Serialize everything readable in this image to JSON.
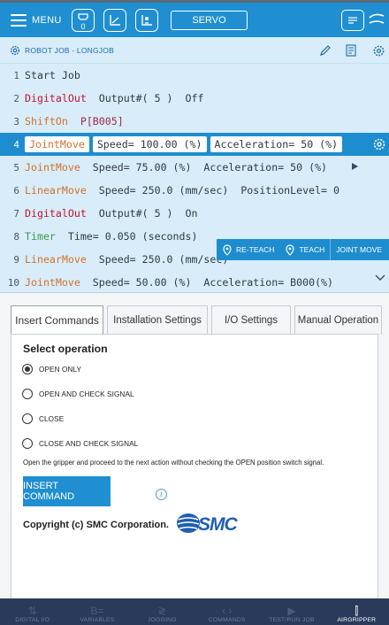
{
  "topbar": {
    "menu_label": "MENU",
    "servo_label": "SERVO",
    "gripper_badge": "0",
    "accent_color": "#1f8fd1"
  },
  "job": {
    "title": "ROBOT JOB - LONGJOB",
    "lines": [
      {
        "num": "1",
        "keyword": "Start Job",
        "rest": ""
      },
      {
        "num": "2",
        "keyword": "DigitalOut",
        "rest": "  Output#( 5 )  Off"
      },
      {
        "num": "3",
        "keyword": "ShiftOn",
        "rest": "  P[B005]"
      },
      {
        "num": "4",
        "keyword": "JointMove",
        "chip1": "Speed= 100.00 (%)",
        "chip2": "Acceleration= 50 (%)"
      },
      {
        "num": "5",
        "keyword": "JointMove",
        "rest": "  Speed= 75.00 (%)  Acceleration= 50 (%)"
      },
      {
        "num": "6",
        "keyword": "LinearMove",
        "rest": "  Speed= 250.0 (mm/sec)  PositionLevel= 0"
      },
      {
        "num": "7",
        "keyword": "DigitalOut",
        "rest": "  Output#( 5 )  On"
      },
      {
        "num": "8",
        "keyword": "Timer",
        "rest": "  Time= 0.050 (seconds)"
      },
      {
        "num": "9",
        "keyword": "LinearMove",
        "rest": "  Speed= 250.0 (mm/sec)"
      },
      {
        "num": "10",
        "keyword": "JointMove",
        "rest": "  Speed= 50.00 (%)  Acceleration= B000(%)"
      }
    ],
    "actions": {
      "reteach": "RE-TEACH",
      "teach": "TEACH",
      "joint_move": "JOINT MOVE"
    }
  },
  "tabs": [
    {
      "label": "Insert Commands",
      "active": true
    },
    {
      "label": "Installation Settings",
      "active": false
    },
    {
      "label": "I/O Settings",
      "active": false
    },
    {
      "label": "Manual Operation",
      "active": false
    }
  ],
  "panel": {
    "select_title": "Select operation",
    "options": [
      {
        "label": "OPEN ONLY",
        "selected": true
      },
      {
        "label": "OPEN AND CHECK SIGNAL",
        "selected": false
      },
      {
        "label": "CLOSE",
        "selected": false
      },
      {
        "label": "CLOSE AND CHECK SIGNAL",
        "selected": false
      }
    ],
    "description": "Open the gripper and proceed to the next action without checking the OPEN position switch signal.",
    "insert_button": "INSERT COMMAND",
    "info_glyph": "i",
    "copyright": "Copyright (c) SMC Corporation.",
    "logo_text": "SMC"
  },
  "bottom_nav": [
    {
      "label": "DIGITAL I/O",
      "glyph": "⇅",
      "active": false
    },
    {
      "label": "VARIABLES",
      "glyph": "B=",
      "active": false
    },
    {
      "label": "JOGGING",
      "glyph": "≷",
      "active": false
    },
    {
      "label": "COMMANDS",
      "glyph": "‹ ›",
      "active": false
    },
    {
      "label": "TEST/RUN JOB",
      "glyph": "▶",
      "active": false
    },
    {
      "label": "AIRGRIPPER",
      "glyph": "⫿",
      "active": true
    }
  ]
}
